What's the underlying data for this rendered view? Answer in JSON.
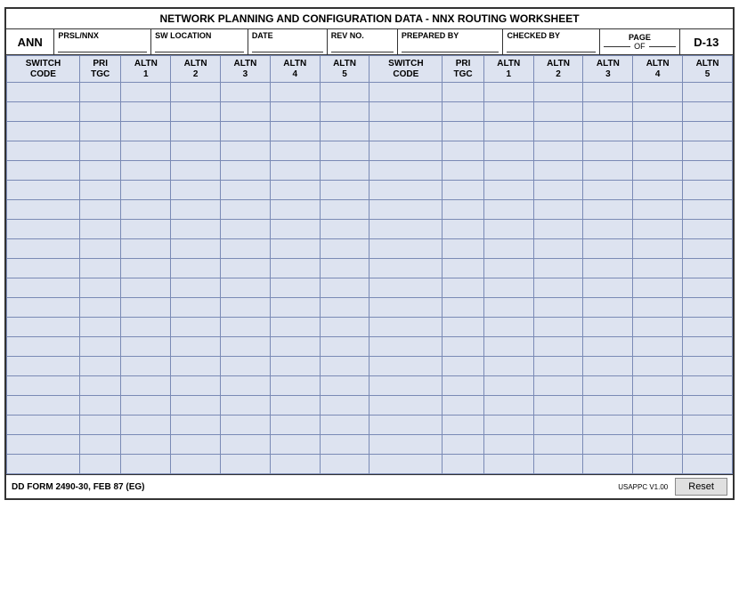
{
  "title": "NETWORK PLANNING AND CONFIGURATION DATA - NNX ROUTING WORKSHEET",
  "header": {
    "ann_label": "ANN",
    "prslnnx_label": "PRSL/NNX",
    "sw_location_label": "SW LOCATION",
    "date_label": "DATE",
    "rev_no_label": "REV NO.",
    "prepared_by_label": "PREPARED BY",
    "checked_by_label": "CHECKED BY",
    "page_label": "PAGE",
    "of_label": "OF",
    "form_id": "D-13"
  },
  "columns": [
    {
      "id": "switch_code_1",
      "label": "SWITCH\nCODE"
    },
    {
      "id": "pri_tgc_1",
      "label": "PRI\nTGC"
    },
    {
      "id": "altn1_1",
      "label": "ALTN\n1"
    },
    {
      "id": "altn2_1",
      "label": "ALTN\n2"
    },
    {
      "id": "altn3_1",
      "label": "ALTN\n3"
    },
    {
      "id": "altn4_1",
      "label": "ALTN\n4"
    },
    {
      "id": "altn5_1",
      "label": "ALTN\n5"
    },
    {
      "id": "switch_code_2",
      "label": "SWITCH\nCODE"
    },
    {
      "id": "pri_tgc_2",
      "label": "PRI\nTGC"
    },
    {
      "id": "altn1_2",
      "label": "ALTN\n1"
    },
    {
      "id": "altn2_2",
      "label": "ALTN\n2"
    },
    {
      "id": "altn3_2",
      "label": "ALTN\n3"
    },
    {
      "id": "altn4_2",
      "label": "ALTN\n4"
    },
    {
      "id": "altn5_2",
      "label": "ALTN\n5"
    }
  ],
  "num_data_rows": 20,
  "footer": {
    "form_label": "DD FORM 2490-30, FEB 87 (EG)",
    "version": "USAPPC V1.00",
    "reset_button": "Reset"
  }
}
